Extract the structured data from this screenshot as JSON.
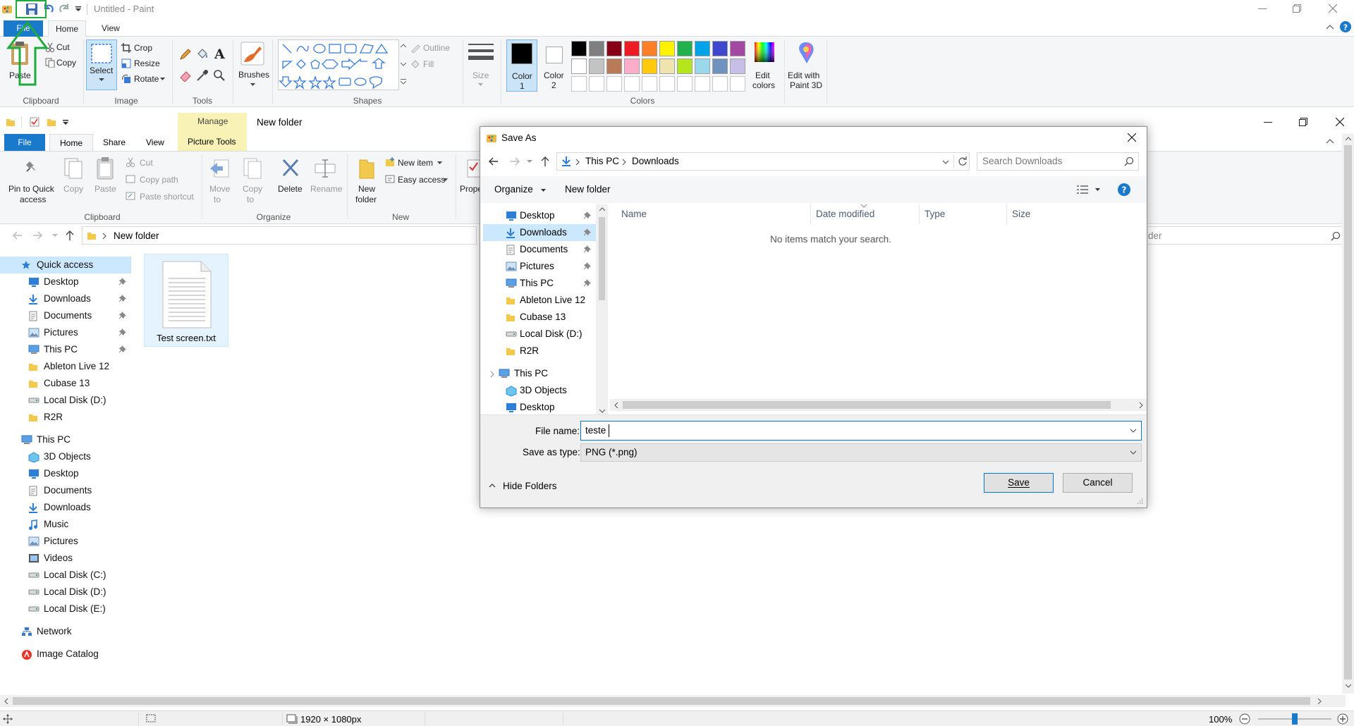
{
  "paint": {
    "title": "Untitled - Paint",
    "tabs": {
      "file": "File",
      "home": "Home",
      "view": "View"
    },
    "clipboard": {
      "paste": "Paste",
      "cut": "Cut",
      "copy": "Copy",
      "group": "Clipboard"
    },
    "image": {
      "select": "Select",
      "crop": "Crop",
      "resize": "Resize",
      "rotate": "Rotate",
      "group": "Image"
    },
    "tools": {
      "group": "Tools"
    },
    "brushes": {
      "label": "Brushes"
    },
    "shapes": {
      "outline": "Outline",
      "fill": "Fill",
      "group": "Shapes"
    },
    "size": {
      "label": "Size"
    },
    "colors": {
      "color1": "Color\n1",
      "color1_line1": "Color",
      "color1_line2": "1",
      "color2_line1": "Color",
      "color2_line2": "2",
      "edit_line1": "Edit",
      "edit_line2": "colors",
      "paint3d_line1": "Edit with",
      "paint3d_line2": "Paint 3D",
      "group": "Colors",
      "row1": [
        "#000000",
        "#7f7f7f",
        "#880015",
        "#ed1c24",
        "#ff7f27",
        "#fff200",
        "#22b14c",
        "#00a2e8",
        "#3f48cc",
        "#a349a4"
      ],
      "row2": [
        "#ffffff",
        "#c3c3c3",
        "#b97a57",
        "#ffaec9",
        "#ffc90e",
        "#efe4b0",
        "#b5e61d",
        "#99d9ea",
        "#7092be",
        "#c8bfe7"
      ]
    }
  },
  "explorer": {
    "title": "New folder",
    "manage": "Manage",
    "tabs": {
      "file": "File",
      "home": "Home",
      "share": "Share",
      "view": "View",
      "picture_tools": "Picture Tools"
    },
    "ribbon": {
      "pin_line1": "Pin to Quick",
      "pin_line2": "access",
      "copy": "Copy",
      "paste": "Paste",
      "cut": "Cut",
      "copy_path": "Copy path",
      "paste_shortcut": "Paste shortcut",
      "clipboard_group": "Clipboard",
      "move_line1": "Move",
      "move_line2": "to",
      "copyto_line1": "Copy",
      "copyto_line2": "to",
      "delete": "Delete",
      "rename": "Rename",
      "organize_group": "Organize",
      "newfolder_line1": "New",
      "newfolder_line2": "folder",
      "new_item": "New item",
      "easy_access": "Easy access",
      "new_group": "New",
      "properties": "Prope"
    },
    "address": "New folder",
    "search_partial": "lder",
    "nav": {
      "quick_access": "Quick access",
      "qa_items": [
        "Desktop",
        "Downloads",
        "Documents",
        "Pictures",
        "This PC",
        "Ableton Live 12",
        "Cubase 13",
        "Local Disk (D:)",
        "R2R"
      ],
      "this_pc": "This PC",
      "pc_items": [
        "3D Objects",
        "Desktop",
        "Documents",
        "Downloads",
        "Music",
        "Pictures",
        "Videos",
        "Local Disk (C:)",
        "Local Disk (D:)",
        "Local Disk (E:)"
      ],
      "network": "Network",
      "image_catalog": "Image Catalog"
    },
    "file": {
      "name": "Test screen.txt"
    }
  },
  "dialog": {
    "title": "Save As",
    "breadcrumb": [
      "This PC",
      "Downloads"
    ],
    "search_placeholder": "Search Downloads",
    "organize": "Organize",
    "new_folder": "New folder",
    "nav_items": [
      "Desktop",
      "Downloads",
      "Documents",
      "Pictures",
      "This PC",
      "Ableton Live 12",
      "Cubase 13",
      "Local Disk (D:)",
      "R2R"
    ],
    "this_pc": "This PC",
    "pc_items": [
      "3D Objects",
      "Desktop"
    ],
    "columns": {
      "name": "Name",
      "date": "Date modified",
      "type": "Type",
      "size": "Size"
    },
    "empty_message": "No items match your search.",
    "filename_label": "File name:",
    "filename_value": "teste",
    "type_label": "Save as type:",
    "type_value": "PNG (*.png)",
    "hide_folders": "Hide Folders",
    "save": "Save",
    "cancel": "Cancel"
  },
  "status": {
    "dimensions": "1920 × 1080px",
    "zoom": "100%"
  }
}
